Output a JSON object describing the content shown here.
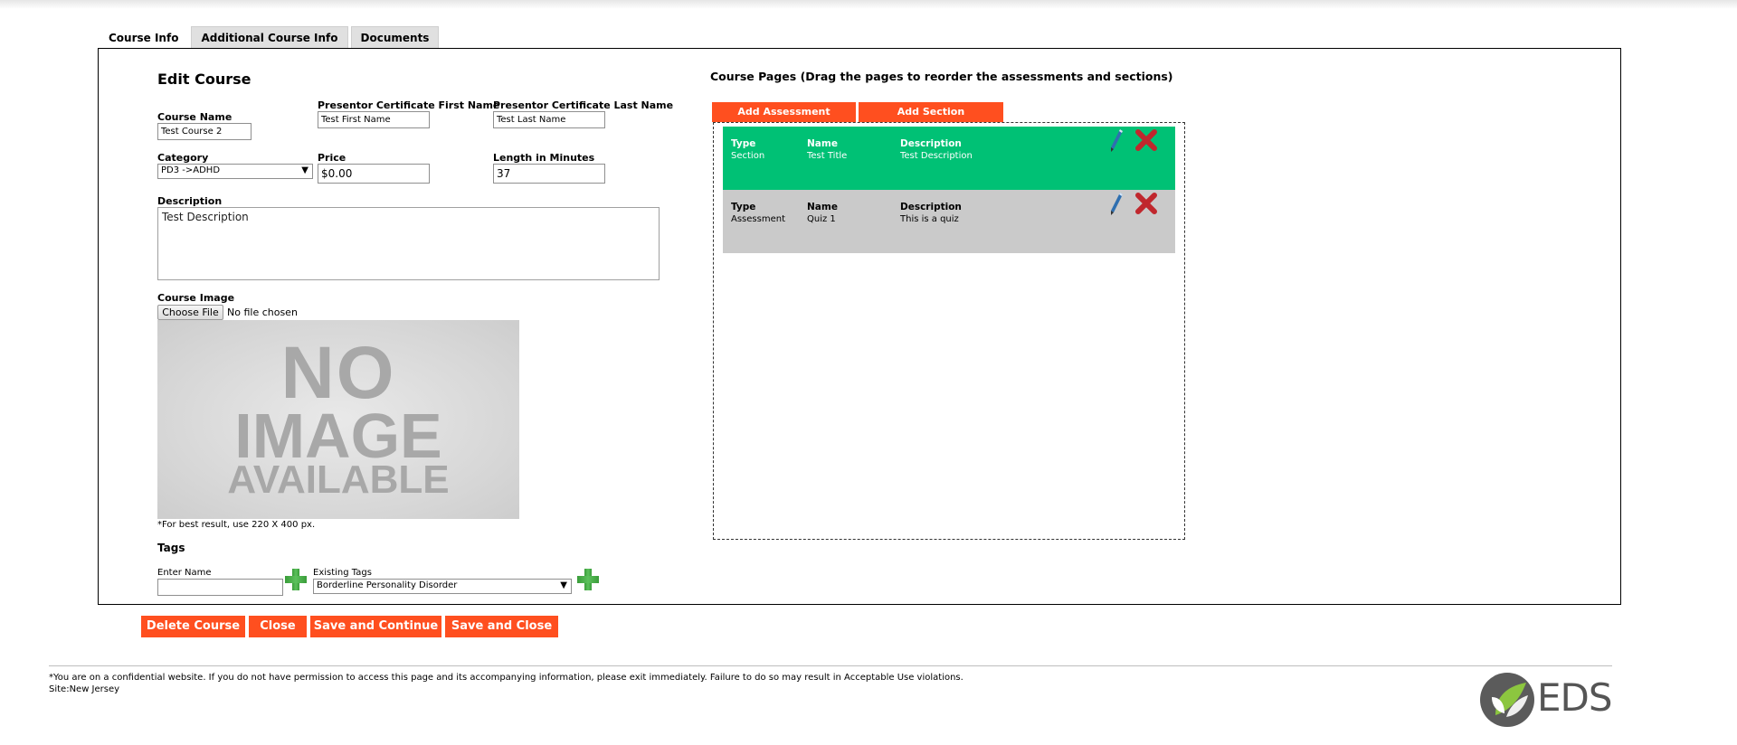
{
  "tabs": [
    "Course Info",
    "Additional Course Info",
    "Documents"
  ],
  "form": {
    "heading": "Edit Course",
    "course_name_label": "Course Name",
    "course_name_value": "Test Course 2",
    "first_name_label": "Presentor Certificate First Name",
    "first_name_value": "Test First Name",
    "last_name_label": "Presentor Certificate Last Name",
    "last_name_value": "Test Last Name",
    "category_label": "Category",
    "category_value": "PD3 ->ADHD",
    "price_label": "Price",
    "price_value": "$0.00",
    "length_label": "Length in Minutes",
    "length_value": "37",
    "description_label": "Description",
    "description_value": "Test Description",
    "image_label": "Course Image",
    "choose_file": "Choose File",
    "no_file": "No file chosen",
    "no_image_lines": [
      "NO",
      "IMAGE",
      "AVAILABLE"
    ],
    "image_hint": "*For best result, use 220 X 400 px."
  },
  "tags": {
    "heading": "Tags",
    "enter_name_label": "Enter Name",
    "enter_name_value": "",
    "existing_label": "Existing Tags",
    "existing_value": "Borderline Personality Disorder"
  },
  "course_pages": {
    "title": "Course Pages (Drag the pages to reorder the assessments and sections)",
    "add_assessment": "Add Assessment",
    "add_section": "Add Section",
    "headers": {
      "type": "Type",
      "name": "Name",
      "description": "Description"
    },
    "rows": [
      {
        "type": "Section",
        "name": "Test Title",
        "description": "Test Description",
        "color": "#00c175"
      },
      {
        "type": "Assessment",
        "name": "Quiz 1",
        "description": "This is a quiz",
        "color": "#cacaca"
      }
    ]
  },
  "actions": {
    "delete": "Delete Course",
    "close": "Close",
    "save_continue": "Save and Continue",
    "save_close": "Save and Close"
  },
  "footer": {
    "notice": "*You are on a confidential website. If you do not have permission to access this page and its accompanying information, please exit immediately. Failure to do so may result in Acceptable Use violations.",
    "site": "Site:New Jersey",
    "logo_text": "EDS"
  },
  "colors": {
    "accent": "#ff4f1f",
    "section_row": "#00c175",
    "assessment_row": "#cacaca"
  },
  "icons": [
    "edit-pencil-icon",
    "delete-x-icon",
    "add-plus-icon",
    "dropdown-caret-icon",
    "eds-leaf-logo"
  ]
}
